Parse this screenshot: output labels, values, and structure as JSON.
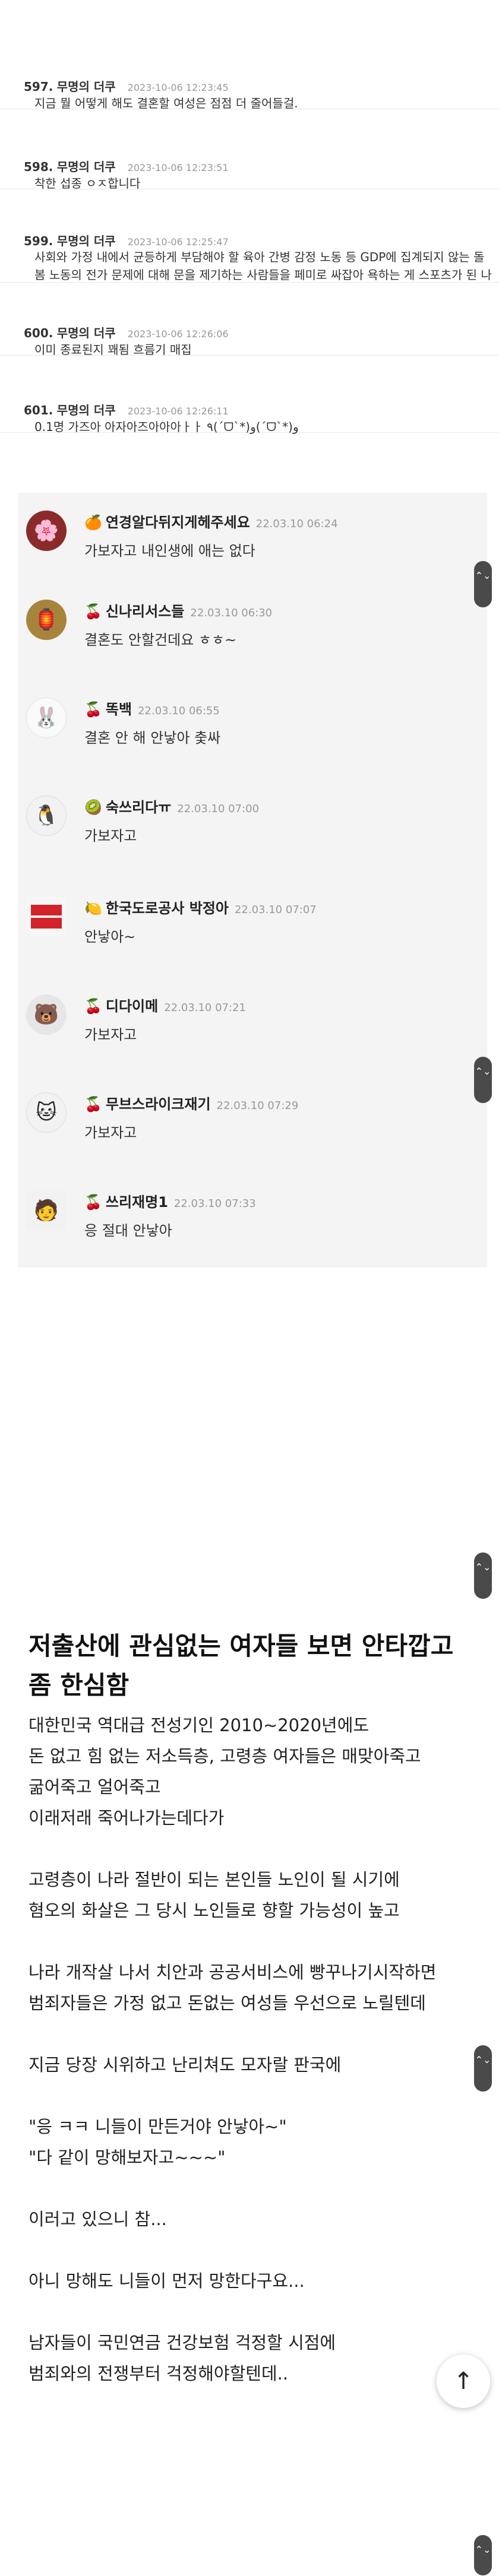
{
  "comments": [
    {
      "num": "597.",
      "nick": "무명의 더쿠",
      "date": "2023-10-06 12:23:45",
      "text": "지금 뭘 어떻게 해도 결혼할 여성은 점점 더 줄어들걸."
    },
    {
      "num": "598.",
      "nick": "무명의 더쿠",
      "date": "2023-10-06 12:23:51",
      "text": "착한 섭종 ㅇㅈ합니다"
    },
    {
      "num": "599.",
      "nick": "무명의 더쿠",
      "date": "2023-10-06 12:25:47",
      "text": "사회와 가정 내에서 균등하게 부담해야 할 육아 간병 감정 노동 등 GDP에 집계되지 않는 돌봄 노동의 전가 문제에 대해 문을 제기하는 사람들을 페미로 싸잡아 욕하는 게 스포츠가 된 나라에서 근"
    },
    {
      "num": "600.",
      "nick": "무명의 더쿠",
      "date": "2023-10-06 12:26:06",
      "text": "이미 종료된지 꽤됨 흐름기 매집"
    },
    {
      "num": "601.",
      "nick": "무명의 더쿠",
      "date": "2023-10-06 12:26:11",
      "text": "0.1명 가즈아 아자아즈아아아ㅏㅏ ٩(ˊᗜˋ*)و(ˊᗜˋ*)و"
    }
  ],
  "chat": [
    {
      "avatar_icon": "profile-photo-icon",
      "badge": "🍊",
      "name": "연경알다뒤지게헤주세요",
      "time": "22.03.10 06:24",
      "text": "가보자고 내인생에 애는 없다"
    },
    {
      "avatar_icon": "profile-photo-icon",
      "badge": "🍒",
      "name": "신나리서스들",
      "time": "22.03.10 06:30",
      "text": "결혼도 안할건데요 ㅎㅎ~"
    },
    {
      "avatar_icon": "rabbit-icon",
      "badge": "🍒",
      "name": "똑백",
      "time": "22.03.10 06:55",
      "text": "결혼 안 해 안낳아 춫싸"
    },
    {
      "avatar_icon": "penguin-icon",
      "badge": "🥝",
      "name": "숙쓰리다ㅠ",
      "time": "22.03.10 07:00",
      "text": "가보자고"
    },
    {
      "avatar_icon": "text-logo-icon",
      "badge": "🍋",
      "name": "한국도로공사 박정아",
      "time": "22.03.10 07:07",
      "text": "안낳아~"
    },
    {
      "avatar_icon": "bear-icon",
      "badge": "🍒",
      "name": "디다이메",
      "time": "22.03.10 07:21",
      "text": "가보자고"
    },
    {
      "avatar_icon": "cat-icon",
      "badge": "🍒",
      "name": "무브스라이크재기",
      "time": "22.03.10 07:29",
      "text": "가보자고"
    },
    {
      "avatar_icon": "character-icon",
      "badge": "🍒",
      "name": "쓰리재명1",
      "time": "22.03.10 07:33",
      "text": "응 절대 안낳아"
    }
  ],
  "article": {
    "title": "저출산에 관심없는 여자들 보면 안타깝고 좀 한심함",
    "paragraphs": [
      [
        "대한민국 역대급 전성기인 2010~2020년에도",
        "돈 없고 힘 없는 저소득층, 고령층 여자들은 매맞아죽고",
        "굶어죽고 얼어죽고",
        "이래저래 죽어나가는데다가"
      ],
      [
        "고령층이 나라 절반이 되는 본인들 노인이 될 시기에",
        "혐오의 화살은 그 당시 노인들로 향할 가능성이 높고"
      ],
      [
        "나라 개작살 나서 치안과 공공서비스에 빵꾸나기시작하면",
        "범죄자들은 가정 없고 돈없는 여성들 우선으로 노릴텐데"
      ],
      [
        "지금 당장 시위하고 난리쳐도 모자랄 판국에"
      ],
      [
        "\"응 ㅋㅋ 니들이 만든거야 안낳아~\"",
        "\"다 같이 망해보자고~~~\""
      ],
      [
        "이러고 있으니 참..."
      ],
      [
        "아니 망해도 니들이 먼저 망한다구요..."
      ],
      [
        "남자들이 국민연금 건강보험 걱정할 시점에",
        "범죄와의 전쟁부터 걱정해야할텐데.."
      ]
    ]
  },
  "ui": {
    "scroll_label": "⌃⌄",
    "top_button_icon": "arrow-up-icon",
    "top_button_glyph": "↑"
  }
}
